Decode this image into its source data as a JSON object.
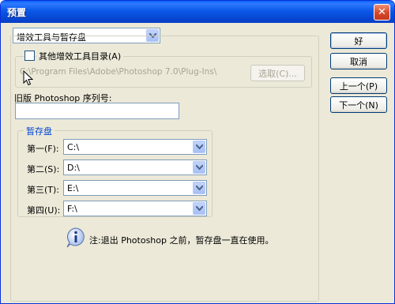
{
  "window": {
    "title": "预置",
    "close_glyph": "✕"
  },
  "category_select": {
    "value": "增效工具与暂存盘"
  },
  "plugins": {
    "checkbox_label": "其他增效工具目录(A)",
    "path": "C:\\Program Files\\Adobe\\Photoshop 7.0\\Plug-Ins\\",
    "choose_button": "选取(C)..."
  },
  "serial": {
    "label": "旧版 Photoshop 序列号:",
    "value": ""
  },
  "scratch": {
    "legend": "暂存盘",
    "disks": [
      {
        "label": "第一(F):",
        "value": "C:\\"
      },
      {
        "label": "第二(S):",
        "value": "D:\\"
      },
      {
        "label": "第三(T):",
        "value": "E:\\"
      },
      {
        "label": "第四(U):",
        "value": "F:\\"
      }
    ],
    "note": "注:退出 Photoshop 之前，暂存盘一直在使用。"
  },
  "buttons": {
    "ok": "好",
    "cancel": "取消",
    "prev": "上一个(P)",
    "next": "下一个(N)"
  },
  "colors": {
    "title_bar": "#0a58e8",
    "dialog_bg": "#ece9d8",
    "accent_text": "#0046d5"
  }
}
